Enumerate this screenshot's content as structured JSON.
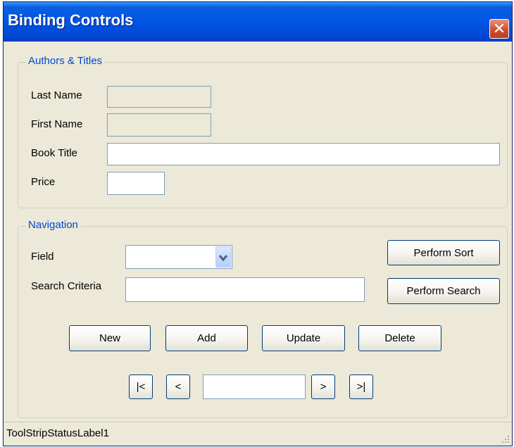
{
  "window": {
    "title": "Binding Controls",
    "close_glyph": "✕"
  },
  "authors_group": {
    "legend": "Authors & Titles",
    "last_name": {
      "label": "Last Name",
      "value": ""
    },
    "first_name": {
      "label": "First Name",
      "value": ""
    },
    "book_title": {
      "label": "Book Title",
      "value": ""
    },
    "price": {
      "label": "Price",
      "value": ""
    }
  },
  "navigation_group": {
    "legend": "Navigation",
    "field": {
      "label": "Field",
      "value": ""
    },
    "search_criteria": {
      "label": "Search Criteria",
      "value": ""
    },
    "perform_sort": "Perform Sort",
    "perform_search": "Perform Search",
    "actions": {
      "new": "New",
      "add": "Add",
      "update": "Update",
      "delete": "Delete"
    },
    "nav": {
      "first": "|<",
      "prev": "<",
      "position": "",
      "next": ">",
      "last": ">|"
    }
  },
  "status_bar": {
    "label": "ToolStripStatusLabel1"
  },
  "colors": {
    "title_bar": "#0055e5",
    "window_bg": "#ece9d8",
    "legend_text": "#0046d5",
    "close_button": "#d04a2c"
  },
  "icons": {
    "close": "close-icon",
    "dropdown": "chevron-down-icon",
    "resize_grip": "resize-grip-icon"
  }
}
